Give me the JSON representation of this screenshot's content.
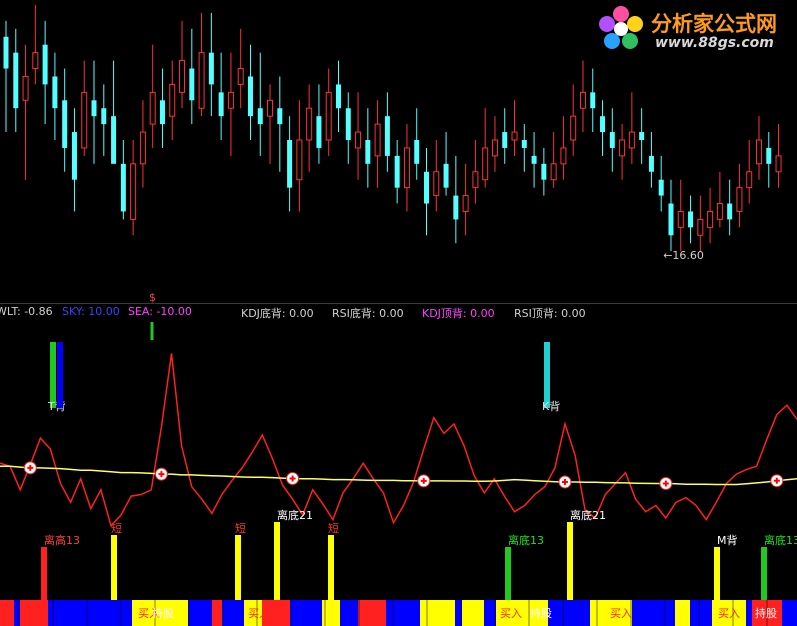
{
  "logo": {
    "text": "分析家公式网",
    "url": "www.88gs.com",
    "icon": "flower-logo-icon"
  },
  "price_panel": {
    "low_annotation": "←16.60",
    "top_marker": "$"
  },
  "legend": {
    "wlt": "WLT: -0.86",
    "sky": "SKY: 10.00",
    "sea": "SEA: -10.00",
    "kdj_bottom": "KDJ底背: 0.00",
    "rsi_bottom": "RSI底背: 0.00",
    "kdj_top": "KDJ顶背: 0.00",
    "rsi_top": "RSI顶背: 0.00"
  },
  "colors": {
    "up": "#ff3232",
    "down": "#54ffff",
    "red_line": "#ff2020",
    "yellow_line": "#ffff60",
    "sky": "#4040ff",
    "sea": "#ff40ff",
    "kdj_top": "#ff40ff",
    "green": "#20c820",
    "blue": "#0000ff",
    "yellow": "#ffff00"
  },
  "chart_data": [
    {
      "type": "candlestick",
      "title": "",
      "low_label": 16.6,
      "candles": [
        [
          30,
          26,
          32,
          18
        ],
        [
          28,
          21,
          31,
          18
        ],
        [
          22,
          25,
          29,
          12
        ],
        [
          26,
          28,
          34,
          24
        ],
        [
          29,
          24,
          32,
          19
        ],
        [
          25,
          21,
          28,
          17
        ],
        [
          22,
          16,
          26,
          13
        ],
        [
          18,
          12,
          21,
          8
        ],
        [
          16,
          23,
          27,
          15
        ],
        [
          22,
          20,
          27,
          14
        ],
        [
          21,
          19,
          24,
          15
        ],
        [
          20,
          14,
          27,
          16
        ],
        [
          14,
          8,
          17,
          7
        ],
        [
          7,
          14,
          17,
          5
        ],
        [
          14,
          18,
          22,
          11
        ],
        [
          19,
          23,
          29,
          16
        ],
        [
          22,
          19,
          26,
          16
        ],
        [
          20,
          24,
          27,
          17
        ],
        [
          23,
          27,
          32,
          21
        ],
        [
          26,
          22,
          31,
          19
        ],
        [
          21,
          28,
          33,
          20
        ],
        [
          28,
          24,
          33,
          20
        ],
        [
          23,
          20,
          28,
          17
        ],
        [
          21,
          23,
          28,
          15
        ],
        [
          24,
          26,
          31,
          21
        ],
        [
          25,
          20,
          29,
          17
        ],
        [
          21,
          19,
          28,
          15
        ],
        [
          20,
          22,
          24,
          14
        ],
        [
          21,
          19,
          25,
          13
        ],
        [
          17,
          11,
          20,
          8
        ],
        [
          12,
          17,
          22,
          8
        ],
        [
          17,
          21,
          24,
          13
        ],
        [
          20,
          16,
          24,
          14
        ],
        [
          17,
          23,
          26,
          15
        ],
        [
          24,
          21,
          27,
          18
        ],
        [
          21,
          17,
          23,
          14
        ],
        [
          16,
          18,
          23,
          12
        ],
        [
          17,
          14,
          21,
          11
        ],
        [
          15,
          19,
          22,
          11
        ],
        [
          20,
          15,
          23,
          13
        ],
        [
          15,
          11,
          17,
          9
        ],
        [
          11,
          16,
          19,
          8
        ],
        [
          17,
          14,
          21,
          12
        ],
        [
          13,
          9,
          16,
          5
        ],
        [
          10,
          13,
          17,
          8
        ],
        [
          14,
          11,
          18,
          10
        ],
        [
          10,
          7,
          15,
          4
        ],
        [
          8,
          10,
          14,
          5
        ],
        [
          11,
          13,
          17,
          9
        ],
        [
          12,
          16,
          21,
          11
        ],
        [
          15,
          17,
          20,
          13
        ],
        [
          18,
          16,
          21,
          14
        ],
        [
          17,
          18,
          22,
          15
        ],
        [
          17,
          16,
          19,
          13
        ],
        [
          15,
          14,
          18,
          11
        ],
        [
          14,
          12,
          16,
          10
        ],
        [
          12,
          14,
          18,
          11
        ],
        [
          14,
          16,
          20,
          12
        ],
        [
          17,
          20,
          24,
          15
        ],
        [
          21,
          23,
          27,
          18
        ],
        [
          23,
          21,
          26,
          18
        ],
        [
          20,
          18,
          22,
          15
        ],
        [
          18,
          16,
          21,
          13
        ],
        [
          15,
          17,
          19,
          12
        ],
        [
          16,
          18,
          23,
          14
        ],
        [
          18,
          17,
          21,
          14
        ],
        [
          15,
          13,
          18,
          11
        ],
        [
          12,
          10,
          15,
          8
        ],
        [
          9,
          5,
          12,
          3
        ],
        [
          6,
          8,
          12,
          3
        ],
        [
          8,
          6,
          10,
          4
        ],
        [
          5,
          7,
          10,
          3
        ],
        [
          6,
          8,
          11,
          4
        ],
        [
          7,
          9,
          13,
          6
        ],
        [
          9,
          7,
          12,
          5
        ],
        [
          8,
          11,
          14,
          6
        ],
        [
          11,
          13,
          17,
          9
        ],
        [
          14,
          17,
          20,
          12
        ],
        [
          16,
          14,
          18,
          11
        ],
        [
          13,
          15,
          19,
          11
        ]
      ]
    },
    {
      "type": "line",
      "title": "",
      "series": [
        {
          "name": "WLT",
          "color": "#ff2020",
          "values": [
            0.5,
            0.3,
            -1.2,
            0.4,
            2.1,
            1.4,
            -0.8,
            -2.0,
            -0.5,
            -2.4,
            -1.2,
            -3.5,
            -2.8,
            -1.6,
            -1.5,
            -1.2,
            2.8,
            7.5,
            1.6,
            -1.0,
            -1.8,
            -2.7,
            -1.5,
            -0.6,
            0.2,
            1.2,
            2.3,
            0.8,
            -0.9,
            -1.8,
            -2.8,
            -1.2,
            -2.1,
            -3.1,
            -1.4,
            -0.5,
            0.5,
            -0.5,
            -1.4,
            -3.3,
            -2.2,
            -0.7,
            1.4,
            3.4,
            2.4,
            3.0,
            1.6,
            -0.3,
            -1.4,
            -0.5,
            -1.6,
            -2.6,
            -2.2,
            -1.5,
            -1.0,
            0.2,
            3.0,
            1.0,
            -2.5,
            -3.0,
            -1.5,
            -0.8,
            -0.1,
            -1.8,
            -2.6,
            -2.2,
            -3.0,
            -2.0,
            -1.7,
            -2.2,
            -3.1,
            -2.0,
            -0.8,
            -0.2,
            0.1,
            0.3,
            2.0,
            3.6,
            4.2,
            3.3
          ]
        },
        {
          "name": "MA",
          "color": "#ffff60",
          "values": [
            0.3,
            0.3,
            0.25,
            0.2,
            0.2,
            0.18,
            0.15,
            0.1,
            0.05,
            0.05,
            0.0,
            -0.05,
            -0.1,
            -0.1,
            -0.12,
            -0.15,
            -0.2,
            -0.2,
            -0.25,
            -0.25,
            -0.28,
            -0.3,
            -0.32,
            -0.35,
            -0.38,
            -0.4,
            -0.4,
            -0.42,
            -0.45,
            -0.48,
            -0.5,
            -0.5,
            -0.52,
            -0.55,
            -0.55,
            -0.56,
            -0.58,
            -0.6,
            -0.6,
            -0.6,
            -0.62,
            -0.62,
            -0.63,
            -0.63,
            -0.63,
            -0.64,
            -0.64,
            -0.65,
            -0.65,
            -0.64,
            -0.6,
            -0.55,
            -0.58,
            -0.62,
            -0.65,
            -0.68,
            -0.7,
            -0.7,
            -0.72,
            -0.72,
            -0.74,
            -0.75,
            -0.76,
            -0.78,
            -0.79,
            -0.8,
            -0.8,
            -0.82,
            -0.84,
            -0.85,
            -0.85,
            -0.86,
            -0.86,
            -0.86,
            -0.82,
            -0.76,
            -0.7,
            -0.62,
            -0.56,
            -0.5
          ]
        }
      ],
      "cross_markers": [
        3,
        16,
        29,
        42,
        56,
        66,
        77,
        87
      ]
    }
  ],
  "signals": {
    "bars_top": [
      {
        "x": 53,
        "color": "#20c820",
        "label": "T背"
      },
      {
        "x": 60,
        "color": "#0000ff",
        "label": ""
      },
      {
        "x": 547,
        "color": "#20d0d0",
        "label": "K背"
      }
    ],
    "bars_bottom": [
      {
        "x": 44,
        "color": "#ff2020",
        "label": "离高13"
      },
      {
        "x": 114,
        "color": "#ffff00",
        "label": "短"
      },
      {
        "x": 238,
        "color": "#ffff00",
        "label": "短"
      },
      {
        "x": 277,
        "color": "#ffff00",
        "label": "离底21"
      },
      {
        "x": 331,
        "color": "#ffff00",
        "label": "短"
      },
      {
        "x": 508,
        "color": "#20c820",
        "label": "离底13"
      },
      {
        "x": 570,
        "color": "#ffff00",
        "label": "离底21"
      },
      {
        "x": 717,
        "color": "#ffff00",
        "label": "M背"
      },
      {
        "x": 764,
        "color": "#20c820",
        "label": "离底13"
      }
    ],
    "strip_labels": [
      {
        "x": 138,
        "text": "买入"
      },
      {
        "x": 152,
        "text": "持股"
      },
      {
        "x": 248,
        "text": "买入"
      },
      {
        "x": 362,
        "text": "买入"
      },
      {
        "x": 500,
        "text": "买入"
      },
      {
        "x": 530,
        "text": "持股"
      },
      {
        "x": 610,
        "text": "买入"
      },
      {
        "x": 718,
        "text": "买入"
      },
      {
        "x": 755,
        "text": "持股"
      }
    ]
  }
}
